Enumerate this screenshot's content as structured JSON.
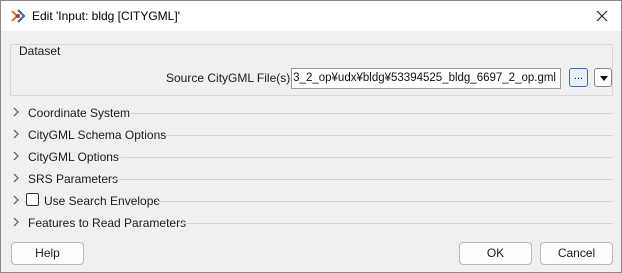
{
  "window": {
    "title": "Edit 'Input: bldg [CITYGML]'"
  },
  "dataset": {
    "group_title": "Dataset",
    "source_label": "Source CityGML File(s):",
    "source_value": "3_2_op¥udx¥bldg¥53394525_bldg_6697_2_op.gml",
    "browse_label": "..."
  },
  "sections": [
    {
      "label": "Coordinate System"
    },
    {
      "label": "CityGML Schema Options"
    },
    {
      "label": "CityGML Options"
    },
    {
      "label": "SRS Parameters"
    },
    {
      "label": "Use Search Envelope",
      "checkbox": true,
      "checked": false
    },
    {
      "label": "Features to Read Parameters"
    }
  ],
  "buttons": {
    "help": "Help",
    "ok": "OK",
    "cancel": "Cancel"
  },
  "icons": {
    "app": "fme-workbench-icon",
    "close": "close-icon",
    "chevron": "chevron-right-icon",
    "menu": "triangle-down-icon"
  }
}
